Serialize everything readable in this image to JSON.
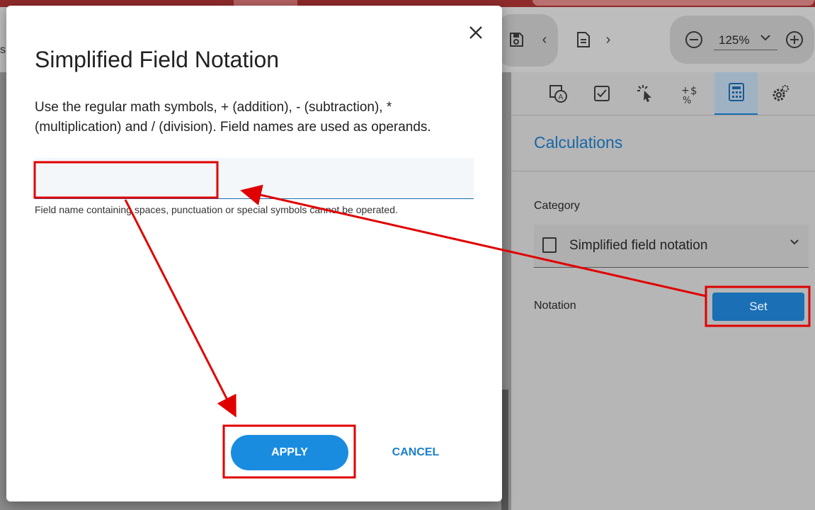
{
  "toolbar": {
    "zoom_level": "125%",
    "left_edge_text": "s"
  },
  "panel": {
    "section_title": "Calculations",
    "category_label": "Category",
    "category_value": "Simplified field notation",
    "notation_label": "Notation",
    "set_button": "Set"
  },
  "dialog": {
    "title": "Simplified Field Notation",
    "description": "Use the regular math symbols, + (addition), - (subtraction), * (multiplication) and / (division). Field names are used as operands.",
    "input_value": "",
    "hint": "Field name containing spaces, punctuation or special symbols cannot be operated.",
    "apply_button": "APPLY",
    "cancel_button": "CANCEL"
  },
  "colors": {
    "accent": "#1a8ce0",
    "annotation": "#e00000"
  }
}
